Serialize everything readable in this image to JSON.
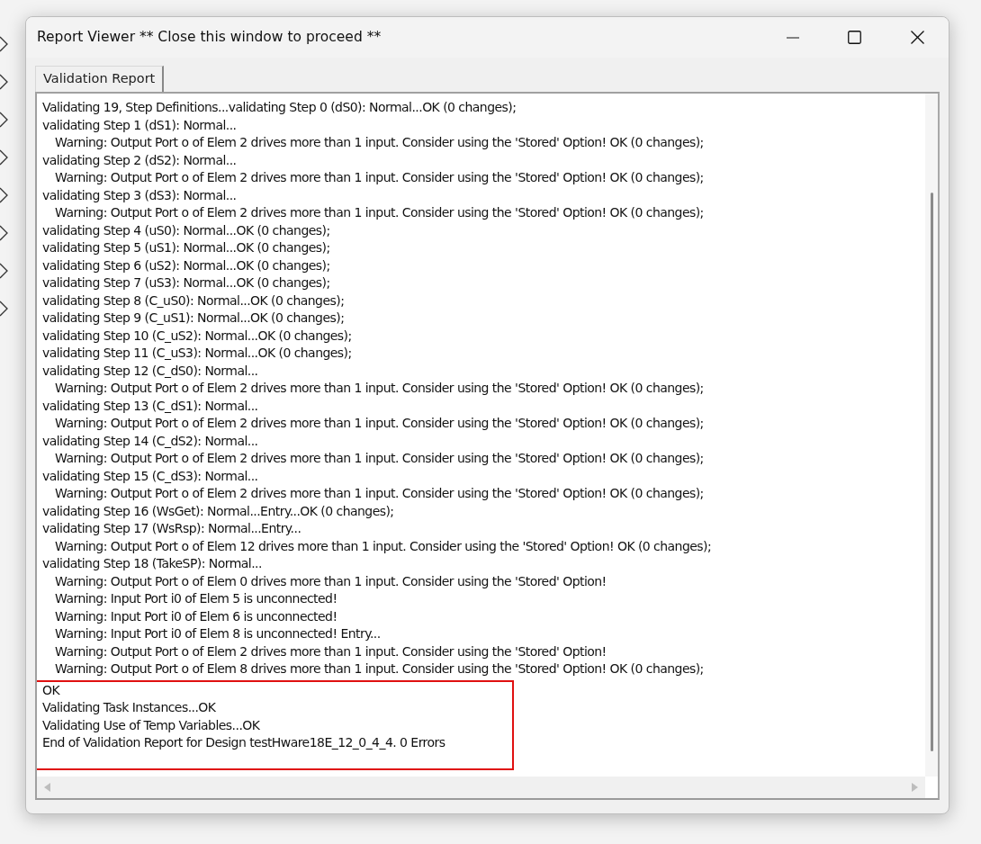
{
  "window": {
    "title": "Report Viewer ** Close this window to proceed **"
  },
  "tabs": [
    {
      "label": "Validation Report",
      "selected": true
    }
  ],
  "report": {
    "lines": [
      {
        "kind": "step",
        "text": "Validating 19, Step Definitions...validating Step 0 (dS0): Normal...OK (0 changes);"
      },
      {
        "kind": "step",
        "text": "validating Step 1 (dS1): Normal..."
      },
      {
        "kind": "warning",
        "text": "Warning: Output Port o of Elem 2 drives more than 1 input. Consider using the 'Stored' Option! OK (0 changes);"
      },
      {
        "kind": "step",
        "text": "validating Step 2 (dS2): Normal..."
      },
      {
        "kind": "warning",
        "text": "Warning: Output Port o of Elem 2 drives more than 1 input. Consider using the 'Stored' Option! OK (0 changes);"
      },
      {
        "kind": "step",
        "text": "validating Step 3 (dS3): Normal..."
      },
      {
        "kind": "warning",
        "text": "Warning: Output Port o of Elem 2 drives more than 1 input. Consider using the 'Stored' Option! OK (0 changes);"
      },
      {
        "kind": "step",
        "text": "validating Step 4 (uS0): Normal...OK (0 changes);"
      },
      {
        "kind": "step",
        "text": "validating Step 5 (uS1): Normal...OK (0 changes);"
      },
      {
        "kind": "step",
        "text": "validating Step 6 (uS2): Normal...OK (0 changes);"
      },
      {
        "kind": "step",
        "text": "validating Step 7 (uS3): Normal...OK (0 changes);"
      },
      {
        "kind": "step",
        "text": "validating Step 8 (C_uS0): Normal...OK (0 changes);"
      },
      {
        "kind": "step",
        "text": "validating Step 9 (C_uS1): Normal...OK (0 changes);"
      },
      {
        "kind": "step",
        "text": "validating Step 10 (C_uS2): Normal...OK (0 changes);"
      },
      {
        "kind": "step",
        "text": "validating Step 11 (C_uS3): Normal...OK (0 changes);"
      },
      {
        "kind": "step",
        "text": "validating Step 12 (C_dS0): Normal..."
      },
      {
        "kind": "warning",
        "text": "Warning: Output Port o of Elem 2 drives more than 1 input. Consider using the 'Stored' Option! OK (0 changes);"
      },
      {
        "kind": "step",
        "text": "validating Step 13 (C_dS1): Normal..."
      },
      {
        "kind": "warning",
        "text": "Warning: Output Port o of Elem 2 drives more than 1 input. Consider using the 'Stored' Option! OK (0 changes);"
      },
      {
        "kind": "step",
        "text": "validating Step 14 (C_dS2): Normal..."
      },
      {
        "kind": "warning",
        "text": "Warning: Output Port o of Elem 2 drives more than 1 input. Consider using the 'Stored' Option! OK (0 changes);"
      },
      {
        "kind": "step",
        "text": "validating Step 15 (C_dS3): Normal..."
      },
      {
        "kind": "warning",
        "text": "Warning: Output Port o of Elem 2 drives more than 1 input. Consider using the 'Stored' Option! OK (0 changes);"
      },
      {
        "kind": "step",
        "text": "validating Step 16 (WsGet): Normal...Entry...OK (0 changes);"
      },
      {
        "kind": "step",
        "text": "validating Step 17 (WsRsp): Normal...Entry..."
      },
      {
        "kind": "warning",
        "text": "Warning: Output Port o of Elem 12 drives more than 1 input. Consider using the 'Stored' Option! OK (0 changes);"
      },
      {
        "kind": "step",
        "text": "validating Step 18 (TakeSP): Normal..."
      },
      {
        "kind": "warning",
        "text": "Warning: Output Port o of Elem 0 drives more than 1 input. Consider using the 'Stored' Option!"
      },
      {
        "kind": "warning",
        "text": "Warning: Input Port i0 of Elem 5 is unconnected!"
      },
      {
        "kind": "warning",
        "text": "Warning: Input Port i0 of Elem 6 is unconnected!"
      },
      {
        "kind": "warning",
        "text": "Warning: Input Port i0 of Elem 8 is unconnected! Entry..."
      },
      {
        "kind": "warning",
        "text": "Warning: Output Port o of Elem 2 drives more than 1 input. Consider using the 'Stored' Option!"
      },
      {
        "kind": "warning",
        "text": "Warning: Output Port o of Elem 8 drives more than 1 input. Consider using the 'Stored' Option! OK (0 changes);"
      }
    ],
    "highlighted_lines": [
      {
        "kind": "step",
        "text": "OK"
      },
      {
        "kind": "step",
        "text": "Validating Task Instances...OK"
      },
      {
        "kind": "step",
        "text": "Validating Use of Temp Variables...OK"
      },
      {
        "kind": "step",
        "text": "End of Validation Report for Design testHware18E_12_0_4_4. 0 Errors"
      }
    ]
  }
}
